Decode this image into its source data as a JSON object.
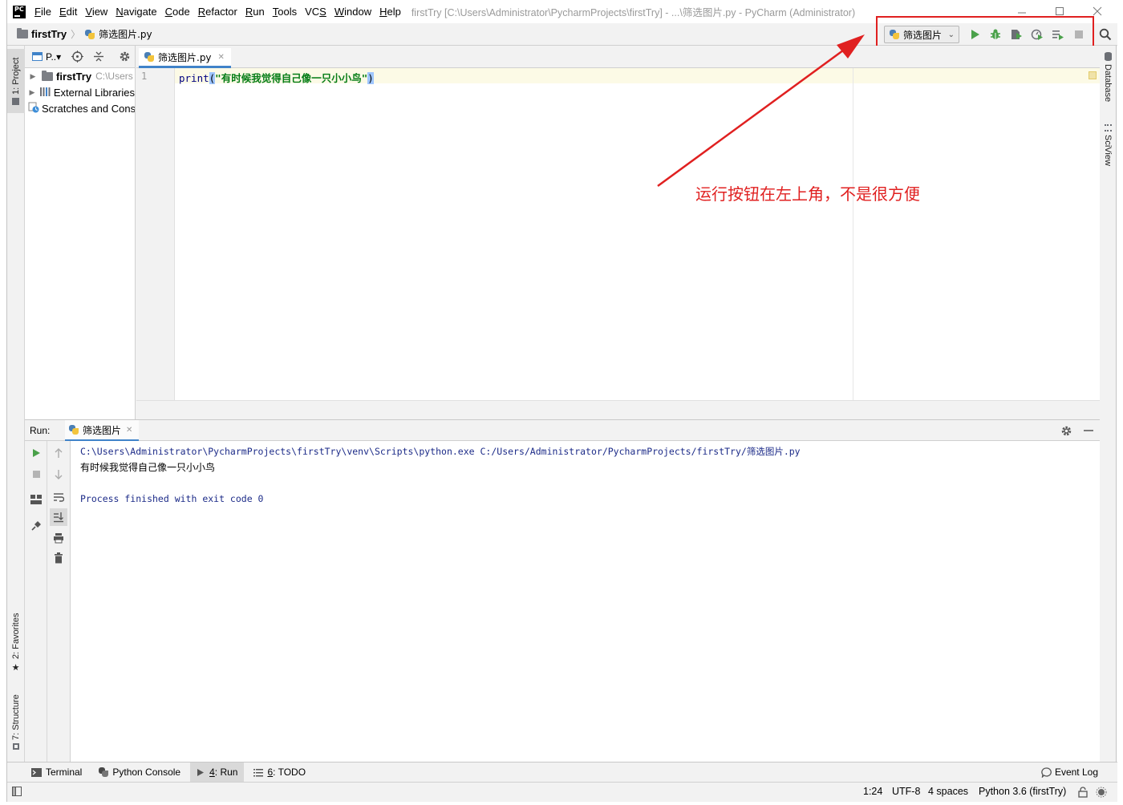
{
  "window": {
    "app_icon_text": "PC",
    "title": "firstTry [C:\\Users\\Administrator\\PycharmProjects\\firstTry] - ...\\筛选图片.py - PyCharm (Administrator)"
  },
  "menu": [
    {
      "label": "File",
      "mnemonic": "F",
      "rest": "ile"
    },
    {
      "label": "Edit",
      "mnemonic": "E",
      "rest": "dit"
    },
    {
      "label": "View",
      "mnemonic": "V",
      "rest": "iew"
    },
    {
      "label": "Navigate",
      "mnemonic": "N",
      "rest": "avigate"
    },
    {
      "label": "Code",
      "mnemonic": "C",
      "rest": "ode"
    },
    {
      "label": "Refactor",
      "mnemonic": "R",
      "rest": "efactor"
    },
    {
      "label": "Run",
      "mnemonic": "R",
      "rest": "un"
    },
    {
      "label": "Tools",
      "mnemonic": "T",
      "rest": "ools"
    },
    {
      "label": "VCS",
      "mnemonic": "S",
      "rest": "VC"
    },
    {
      "label": "Window",
      "mnemonic": "W",
      "rest": "indow"
    },
    {
      "label": "Help",
      "mnemonic": "H",
      "rest": "elp"
    }
  ],
  "navbar": {
    "project": "firstTry",
    "file": "筛选图片.py"
  },
  "run_toolbar": {
    "config_name": "筛选图片"
  },
  "left_strip": {
    "project_tab": "1: Project",
    "favorites_tab": "2: Favorites",
    "structure_tab": "7: Structure"
  },
  "right_strip": {
    "database_tab": "Database",
    "sciview_tab": "SciView"
  },
  "project_panel": {
    "view_selector": "P..▾",
    "tree": [
      {
        "label": "firstTry",
        "hint": "C:\\Users"
      },
      {
        "label": "External Libraries"
      },
      {
        "label": "Scratches and Consoles"
      }
    ]
  },
  "editor": {
    "tab_label": "筛选图片.py",
    "line_number": "1",
    "code_func": "print",
    "code_open": "(",
    "code_string": "\"有时候我觉得自己像一只小小鸟\"",
    "code_close": ")"
  },
  "annotation": {
    "text": "运行按钮在左上角，不是很方便",
    "color": "#e02020"
  },
  "run_panel": {
    "label": "Run:",
    "tab_label": "筛选图片",
    "console_lines": [
      "C:\\Users\\Administrator\\PycharmProjects\\firstTry\\venv\\Scripts\\python.exe C:/Users/Administrator/PycharmProjects/firstTry/筛选图片.py",
      "有时候我觉得自己像一只小小鸟",
      "Process finished with exit code 0"
    ]
  },
  "bottom_tabs": [
    {
      "label": "Terminal"
    },
    {
      "label": "Python Console"
    },
    {
      "label": "4: Run",
      "num": "4",
      "rest": ": Run"
    },
    {
      "label": "6: TODO",
      "num": "6",
      "rest": ": TODO"
    }
  ],
  "event_log": "Event Log",
  "status_bar": {
    "position": "1:24",
    "encoding": "UTF-8",
    "indent": "4 spaces",
    "interpreter": "Python 3.6 (firstTry)"
  },
  "colors": {
    "run_green": "#4aa14a",
    "accent_blue": "#4083c9"
  }
}
